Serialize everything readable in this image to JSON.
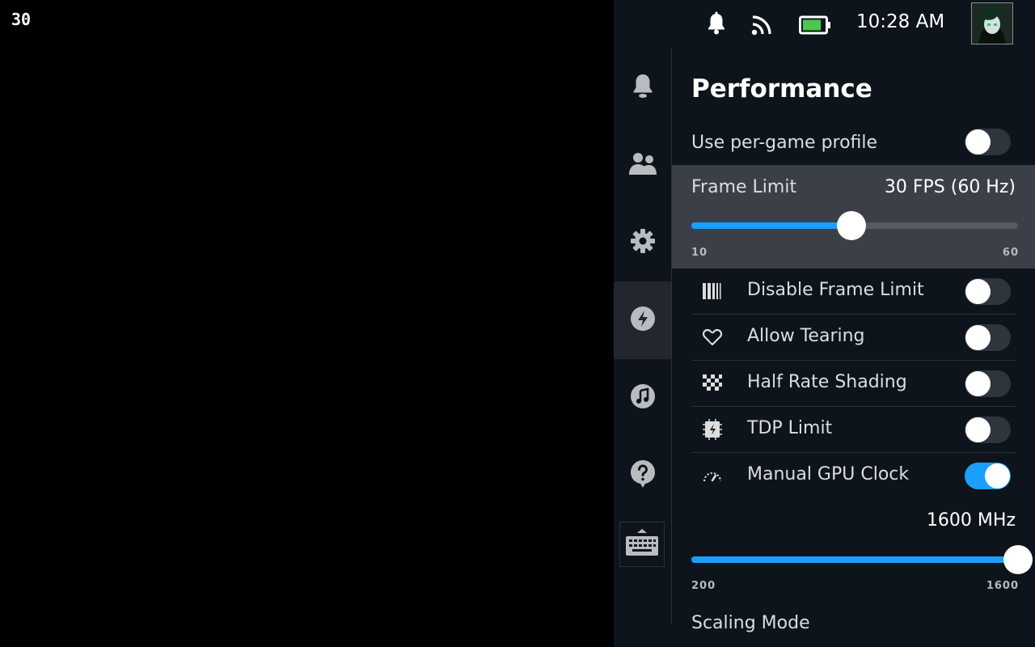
{
  "overlay": {
    "fps": "30"
  },
  "statusbar": {
    "time": "10:28 AM",
    "icons": [
      "bell-icon",
      "wifi-icon",
      "battery-icon"
    ],
    "battery_level": 0.85
  },
  "sidebar": {
    "items": [
      {
        "name": "notifications",
        "icon": "bell-icon",
        "active": false
      },
      {
        "name": "friends",
        "icon": "friends-icon",
        "active": false
      },
      {
        "name": "settings",
        "icon": "gear-icon",
        "active": false
      },
      {
        "name": "performance",
        "icon": "lightning-icon",
        "active": true
      },
      {
        "name": "music",
        "icon": "music-note-icon",
        "active": false
      },
      {
        "name": "help",
        "icon": "help-icon",
        "active": false
      }
    ],
    "keyboard_icon": "keyboard-icon"
  },
  "performance": {
    "title": "Performance",
    "per_game_profile": {
      "label": "Use per-game profile",
      "on": false
    },
    "frame_limit": {
      "label": "Frame Limit",
      "value_text": "30 FPS (60 Hz)",
      "min_label": "10",
      "max_label": "60",
      "value_fraction": 0.49
    },
    "options": [
      {
        "label": "Disable Frame Limit",
        "icon": "frame-limit-bars-icon",
        "on": false
      },
      {
        "label": "Allow Tearing",
        "icon": "tearing-heart-icon",
        "on": false
      },
      {
        "label": "Half Rate Shading",
        "icon": "checkerboard-icon",
        "on": false
      },
      {
        "label": "TDP Limit",
        "icon": "chip-bolt-icon",
        "on": false
      },
      {
        "label": "Manual GPU Clock",
        "icon": "speedometer-icon",
        "on": true
      }
    ],
    "gpu_clock": {
      "value_text": "1600 MHz",
      "min_label": "200",
      "max_label": "1600",
      "value_fraction": 1.0
    },
    "scaling_mode": {
      "label": "Scaling Mode"
    }
  },
  "colors": {
    "accent": "#1a9fff",
    "panel_bg": "#0e141b",
    "highlight_bg": "#3b3f48"
  }
}
